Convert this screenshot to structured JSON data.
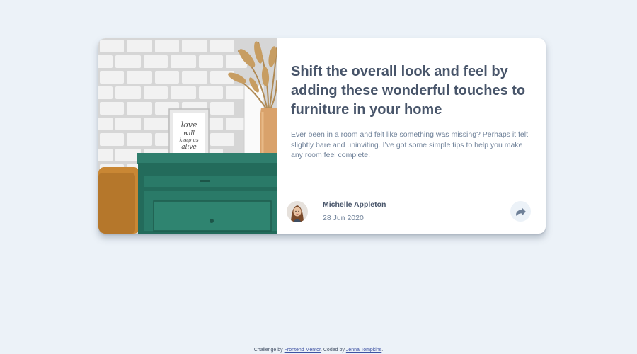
{
  "article": {
    "title": "Shift the overall look and feel by adding these wonderful touches to furniture in your home",
    "description": "Ever been in a room and felt like something was missing? Perhaps it felt slightly bare and uninviting. I’ve got some simple tips to help you make any room feel complete.",
    "image_icon": "drawers-photo",
    "frame_text": [
      "love",
      "will",
      "keep us",
      "alive"
    ]
  },
  "author": {
    "name": "Michelle Appleton",
    "date": "28 Jun 2020",
    "avatar_icon": "avatar-michelle"
  },
  "share": {
    "icon": "share-icon"
  },
  "attribution": {
    "prefix": "Challenge by",
    "link1": "Frontend Mentor",
    "middle": ". Coded by",
    "link2": "Jenna Tompkins",
    "suffix": "."
  },
  "colors": {
    "page_bg": "#ecf2f8",
    "card_bg": "#ffffff",
    "heading": "#48556a",
    "body_text": "#6e8098",
    "link": "#3e52a3",
    "drawer": "#2f7e6d"
  }
}
